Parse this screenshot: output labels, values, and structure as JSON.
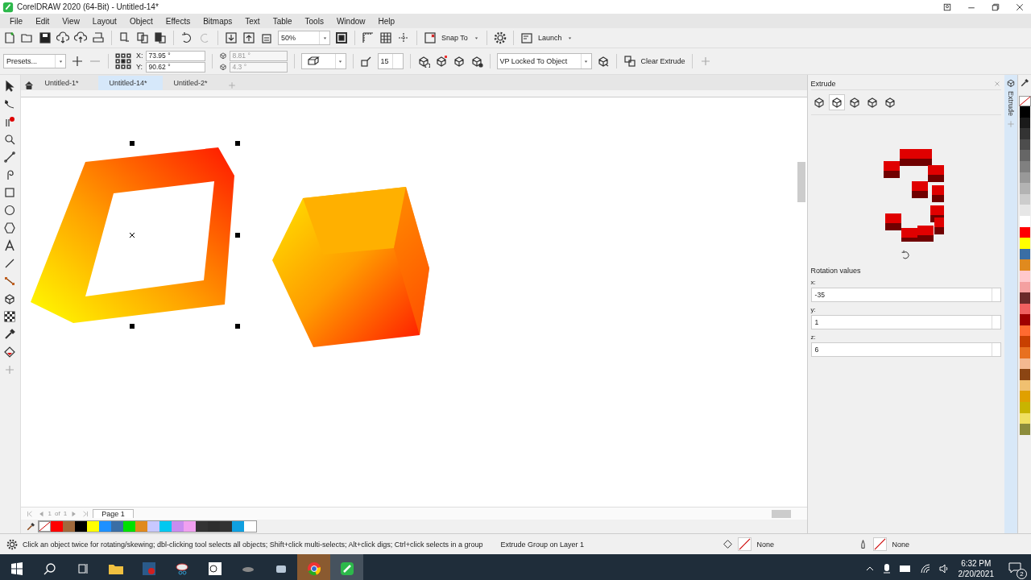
{
  "window": {
    "title": "CorelDRAW 2020 (64-Bit) - Untitled-14*"
  },
  "menu": [
    "File",
    "Edit",
    "View",
    "Layout",
    "Object",
    "Effects",
    "Bitmaps",
    "Text",
    "Table",
    "Tools",
    "Window",
    "Help"
  ],
  "toolbar": {
    "zoom": "50%",
    "snap": "Snap To",
    "launch": "Launch"
  },
  "property_bar": {
    "presets": "Presets...",
    "x_label": "X:",
    "x": "73.95 °",
    "y_label": "Y:",
    "y": "90.62 °",
    "w": "8.81 °",
    "h": "4.3 °",
    "depth": "15",
    "vp": "VP Locked To Object",
    "clear": "Clear Extrude"
  },
  "doc_tabs": [
    {
      "label": "Untitled-1*",
      "selected": false
    },
    {
      "label": "Untitled-14*",
      "selected": true
    },
    {
      "label": "Untitled-2*",
      "selected": false
    }
  ],
  "docker": {
    "title": "Extrude",
    "tab": "Extrude",
    "modes": [
      {
        "selected": false
      },
      {
        "selected": true
      },
      {
        "selected": false
      },
      {
        "selected": false
      },
      {
        "selected": false
      }
    ],
    "section": "Rotation values",
    "fields": [
      {
        "label": "x:",
        "value": "-35"
      },
      {
        "label": "y:",
        "value": "1"
      },
      {
        "label": "z:",
        "value": "6"
      }
    ]
  },
  "side_palette": [
    {
      "color": "#000000"
    },
    {
      "color": "#1a1a1a"
    },
    {
      "color": "#333333"
    },
    {
      "color": "#4d4d4d"
    },
    {
      "color": "#666666"
    },
    {
      "color": "#808080"
    },
    {
      "color": "#999999"
    },
    {
      "color": "#b3b3b3"
    },
    {
      "color": "#cccccc"
    },
    {
      "color": "#e6e6e6"
    },
    {
      "color": "#ffffff"
    },
    {
      "color": "#ff0000"
    },
    {
      "color": "#ffff00"
    },
    {
      "color": "#3a6ea5"
    },
    {
      "color": "#e08a1e"
    },
    {
      "color": "#ffc8cc"
    },
    {
      "color": "#f4a0a0"
    },
    {
      "color": "#6b2a2a"
    },
    {
      "color": "#f06060"
    },
    {
      "color": "#a00000"
    },
    {
      "color": "#ff6a30"
    },
    {
      "color": "#c84000"
    },
    {
      "color": "#e87020"
    },
    {
      "color": "#f4b890"
    },
    {
      "color": "#8b4513"
    },
    {
      "color": "#f0c070"
    },
    {
      "color": "#e0a000"
    },
    {
      "color": "#c8b400"
    },
    {
      "color": "#f0e060"
    },
    {
      "color": "#8c8c3c"
    }
  ],
  "page_nav": {
    "current": "1",
    "of": "of",
    "total": "1",
    "page_tab": "Page 1"
  },
  "doc_palette": [
    {
      "color": "#ff0000"
    },
    {
      "color": "#a0693c"
    },
    {
      "color": "#000000"
    },
    {
      "color": "#ffff00"
    },
    {
      "color": "#1e90ff"
    },
    {
      "color": "#3a6ea5"
    },
    {
      "color": "#00e000"
    },
    {
      "color": "#e08a1e"
    },
    {
      "color": "#c8c8ff"
    },
    {
      "color": "#00c8f0"
    },
    {
      "color": "#c88cf0"
    },
    {
      "color": "#f0a0f0"
    },
    {
      "color": "#333333"
    },
    {
      "color": "#2e2e2e"
    },
    {
      "color": "#333333"
    },
    {
      "color": "#10a0e0"
    },
    {
      "color": "#ffffff"
    }
  ],
  "status_bar": {
    "hint": "Click an object twice for rotating/skewing; dbl-clicking tool selects all objects; Shift+click multi-selects; Alt+click digs; Ctrl+click selects in a group",
    "object": "Extrude Group on Layer 1",
    "fill": "None",
    "outline": "None"
  },
  "taskbar": {
    "time": "6:32 PM",
    "date": "2/20/2021",
    "notifications": "2"
  }
}
